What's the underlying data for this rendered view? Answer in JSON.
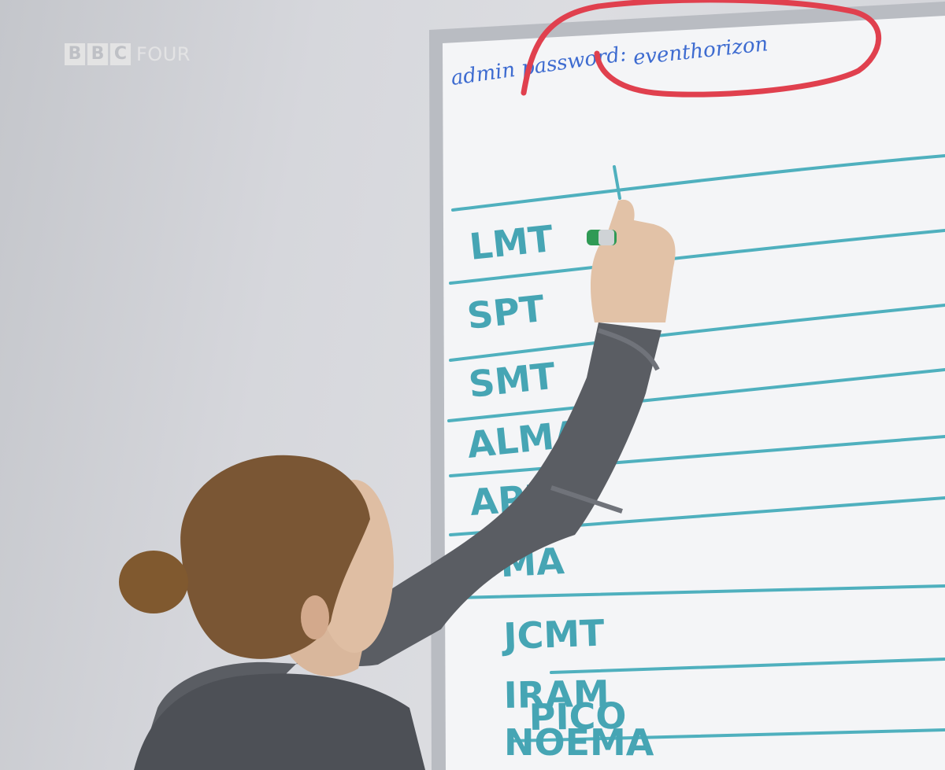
{
  "broadcaster": {
    "letters": [
      "B",
      "B",
      "C"
    ],
    "channel": "FOUR"
  },
  "whiteboard": {
    "header": {
      "label": "admin password:",
      "password": "eventhorizon"
    },
    "rows": [
      "LMT",
      "SPT",
      "SMT",
      "ALMA",
      "APEX",
      "SMA",
      "JCMT",
      "IRAM",
      "NOEMA",
      "PICO"
    ]
  },
  "colors": {
    "marker": "#46a5b4",
    "annotation_ink": "#3d6bd0",
    "highlight_circle": "#e0404e"
  }
}
